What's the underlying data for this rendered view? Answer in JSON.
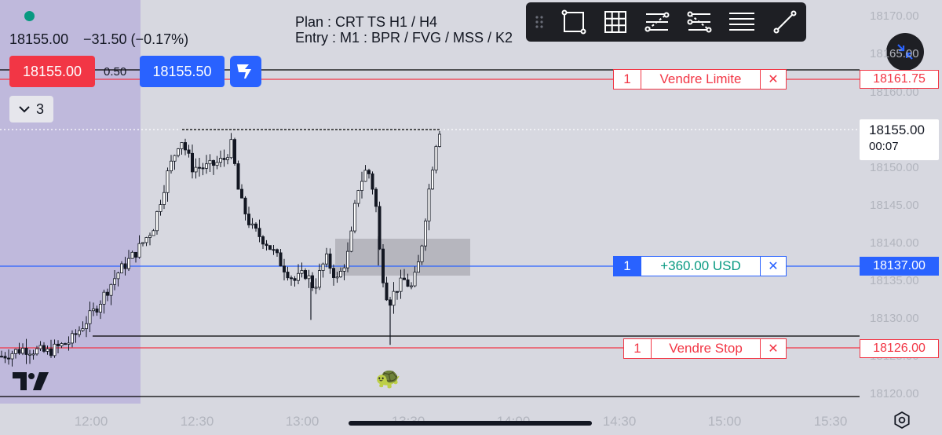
{
  "plan": {
    "line1": "Plan : CRT TS H1 / H4",
    "line2": "Entry : M1 : BPR / FVG / MSS / K2"
  },
  "ticker": {
    "price": "18155.00",
    "change": "−31.50 (−0.17%)",
    "sell_price": "18155.00",
    "spread": "0.50",
    "buy_price": "18155.50",
    "indicators_count": "3"
  },
  "drawing_toolbar": {
    "tools": [
      "drag-handle-icon",
      "rectangle-icon",
      "grid-icon",
      "fib-retracement-icon",
      "pitchfork-icon",
      "horizontal-lines-icon",
      "trendline-icon"
    ]
  },
  "orders": {
    "limit": {
      "qty": "1",
      "label": "Vendre Limite",
      "close": "✕",
      "price": "18161.75"
    },
    "position": {
      "qty": "1",
      "label": "+360.00 USD",
      "close": "✕",
      "price": "18137.00"
    },
    "stop": {
      "qty": "1",
      "label": "Vendre Stop",
      "close": "✕",
      "price": "18126.00"
    }
  },
  "last_price": {
    "price": "18155.00",
    "countdown": "00:07"
  },
  "y_axis": [
    "18170.00",
    "18165.00",
    "18160.00",
    "18150.00",
    "18145.00",
    "18140.00",
    "18135.00",
    "18130.00",
    "18125.00",
    "18120.00"
  ],
  "x_axis": [
    "12:00",
    "12:30",
    "13:00",
    "13:30",
    "14:00",
    "14:30",
    "15:00",
    "15:30"
  ],
  "colors": {
    "background": "#d7d8e0",
    "session_shade": "#b8b4d8",
    "sell_red": "#f23645",
    "buy_blue": "#2962ff",
    "profit_green": "#089981"
  },
  "emoji": {
    "turtle": "🐢"
  },
  "chart_data": {
    "type": "candlestick",
    "y_range": [
      18118,
      18172
    ],
    "x_ticks": [
      "12:00",
      "12:30",
      "13:00",
      "13:30",
      "14:00",
      "14:30",
      "15:00",
      "15:30"
    ],
    "levels": [
      {
        "name": "Vendre Limite",
        "price": 18161.75
      },
      {
        "name": "position",
        "price": 18137.0
      },
      {
        "name": "Vendre Stop",
        "price": 18126.0
      },
      {
        "name": "last",
        "price": 18155.0
      }
    ],
    "range_high": 18155.5,
    "range_low": 18126.5,
    "fvg_box": [
      18135.5,
      18140.5
    ]
  }
}
